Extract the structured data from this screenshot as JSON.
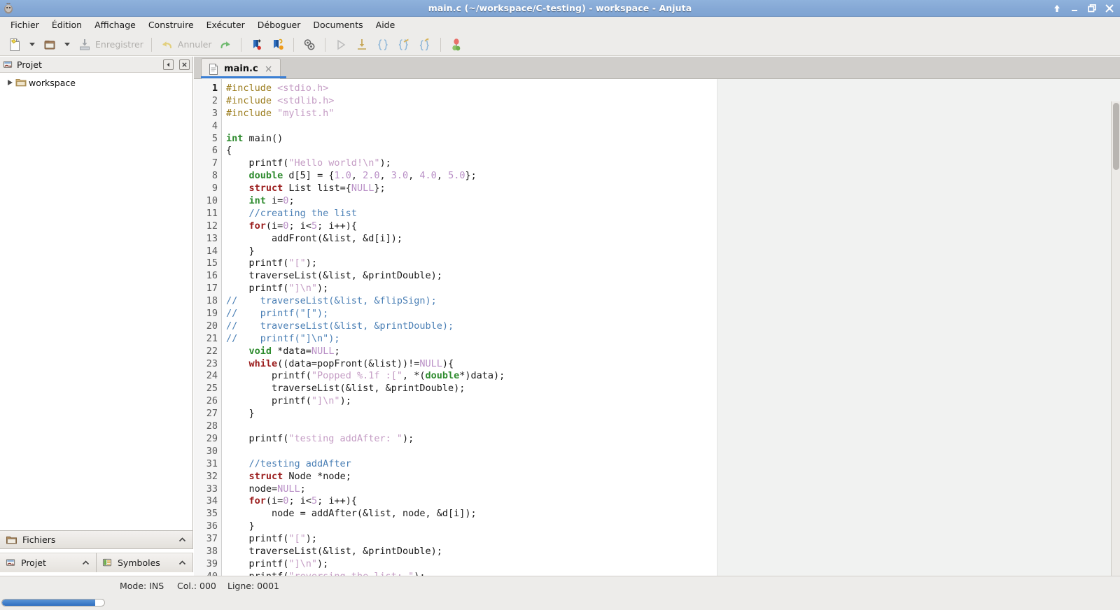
{
  "window": {
    "title": "main.c (~/workspace/C-testing) - workspace - Anjuta",
    "app_icon": "anjuta-icon",
    "controls": [
      {
        "name": "shade-button",
        "glyph": "↑"
      },
      {
        "name": "minimize-button",
        "glyph": "–"
      },
      {
        "name": "maximize-button",
        "glyph": "❐"
      },
      {
        "name": "close-button",
        "glyph": "✕"
      }
    ]
  },
  "menubar": {
    "items": [
      {
        "label": "Fichier"
      },
      {
        "label": "Édition"
      },
      {
        "label": "Affichage"
      },
      {
        "label": "Construire"
      },
      {
        "label": "Exécuter"
      },
      {
        "label": "Déboguer"
      },
      {
        "label": "Documents"
      },
      {
        "label": "Aide"
      }
    ]
  },
  "toolbar": {
    "new_label": "",
    "open_label": "",
    "save_label": "Enregistrer",
    "undo_label": "Annuler",
    "redo_label": "",
    "items": [
      {
        "name": "new-file-button",
        "icon": "new-document-icon",
        "enabled": true
      },
      {
        "name": "new-file-dropdown",
        "icon": "chevron-down-icon",
        "enabled": true
      },
      {
        "name": "open-file-button",
        "icon": "open-folder-icon",
        "enabled": true
      },
      {
        "name": "open-file-dropdown",
        "icon": "chevron-down-icon",
        "enabled": true
      },
      {
        "name": "save-button",
        "icon": "save-icon",
        "enabled": false
      },
      {
        "name": "undo-button",
        "icon": "undo-arrow-icon",
        "enabled": false
      },
      {
        "name": "redo-button",
        "icon": "redo-arrow-icon",
        "enabled": true
      },
      {
        "name": "bookmark-add-button",
        "icon": "bookmark-add-icon",
        "enabled": true
      },
      {
        "name": "bookmark-find-button",
        "icon": "bookmark-find-icon",
        "enabled": true
      },
      {
        "name": "build-button",
        "icon": "gears-icon",
        "enabled": true
      },
      {
        "name": "run-button",
        "icon": "play-triangle-icon",
        "enabled": false
      },
      {
        "name": "step-into-button",
        "icon": "step-into-icon",
        "enabled": false
      },
      {
        "name": "step-braces-button",
        "icon": "step-over-braces-icon",
        "enabled": false
      },
      {
        "name": "step-out-button",
        "icon": "step-out-icon",
        "enabled": false
      },
      {
        "name": "step-next-button",
        "icon": "step-next-icon",
        "enabled": false
      },
      {
        "name": "stop-debug-button",
        "icon": "balloon-stop-icon",
        "enabled": true
      }
    ]
  },
  "left_panel": {
    "header": {
      "icon": "project-icon",
      "title": "Projet",
      "collapse_button": "collapse-panel-icon",
      "close_button": "close-panel-icon"
    },
    "tree": [
      {
        "icon": "folder-icon",
        "label": "workspace",
        "expanded": false
      }
    ],
    "files_expander": {
      "icon": "folder-icon",
      "label": "Fichiers",
      "chevron": "chevron-up-icon"
    },
    "tabs": [
      {
        "name": "sidebar-tab-projet",
        "icon": "project-icon",
        "label": "Projet",
        "chevron": "chevron-up-icon",
        "active": true
      },
      {
        "name": "sidebar-tab-symboles",
        "icon": "symbols-icon",
        "label": "Symboles",
        "chevron": "chevron-up-icon",
        "active": false
      }
    ]
  },
  "editor": {
    "tabs": [
      {
        "name": "editor-tab-main-c",
        "icon": "file-icon",
        "label": "main.c",
        "close": "×",
        "active": true
      }
    ],
    "current_line": 1,
    "first_line": 1,
    "last_visible_line": 40,
    "code": [
      [
        [
          "pp",
          "#include "
        ],
        [
          "st",
          "<stdio.h>"
        ]
      ],
      [
        [
          "pp",
          "#include "
        ],
        [
          "st",
          "<stdlib.h>"
        ]
      ],
      [
        [
          "pp",
          "#include "
        ],
        [
          "st",
          "\"mylist.h\""
        ]
      ],
      [
        [
          "pl",
          ""
        ]
      ],
      [
        [
          "kg",
          "int"
        ],
        [
          "pl",
          " main()"
        ]
      ],
      [
        [
          "pl",
          "{"
        ]
      ],
      [
        [
          "pl",
          "    printf("
        ],
        [
          "st",
          "\"Hello world!\\n\""
        ],
        [
          "pl",
          ");"
        ]
      ],
      [
        [
          "pl",
          "    "
        ],
        [
          "kg",
          "double"
        ],
        [
          "pl",
          " d[5] = {"
        ],
        [
          "nm",
          "1.0"
        ],
        [
          "pl",
          ", "
        ],
        [
          "nm",
          "2.0"
        ],
        [
          "pl",
          ", "
        ],
        [
          "nm",
          "3.0"
        ],
        [
          "pl",
          ", "
        ],
        [
          "nm",
          "4.0"
        ],
        [
          "pl",
          ", "
        ],
        [
          "nm",
          "5.0"
        ],
        [
          "pl",
          "};"
        ]
      ],
      [
        [
          "pl",
          "    "
        ],
        [
          "k",
          "struct"
        ],
        [
          "pl",
          " List list={"
        ],
        [
          "nm",
          "NULL"
        ],
        [
          "pl",
          "};"
        ]
      ],
      [
        [
          "pl",
          "    "
        ],
        [
          "kg",
          "int"
        ],
        [
          "pl",
          " i="
        ],
        [
          "nm",
          "0"
        ],
        [
          "pl",
          ";"
        ]
      ],
      [
        [
          "pl",
          "    "
        ],
        [
          "cm",
          "//creating the list"
        ]
      ],
      [
        [
          "pl",
          "    "
        ],
        [
          "k",
          "for"
        ],
        [
          "pl",
          "(i="
        ],
        [
          "nm",
          "0"
        ],
        [
          "pl",
          "; i<"
        ],
        [
          "nm",
          "5"
        ],
        [
          "pl",
          "; i++){"
        ]
      ],
      [
        [
          "pl",
          "        addFront(&list, &d[i]);"
        ]
      ],
      [
        [
          "pl",
          "    }"
        ]
      ],
      [
        [
          "pl",
          "    printf("
        ],
        [
          "st",
          "\"[\""
        ],
        [
          "pl",
          ");"
        ]
      ],
      [
        [
          "pl",
          "    traverseList(&list, &printDouble);"
        ]
      ],
      [
        [
          "pl",
          "    printf("
        ],
        [
          "st",
          "\"]\\n\""
        ],
        [
          "pl",
          ");"
        ]
      ],
      [
        [
          "cm",
          "//    traverseList(&list, &flipSign);"
        ]
      ],
      [
        [
          "cm",
          "//    printf(\"[\");"
        ]
      ],
      [
        [
          "cm",
          "//    traverseList(&list, &printDouble);"
        ]
      ],
      [
        [
          "cm",
          "//    printf(\"]\\n\");"
        ]
      ],
      [
        [
          "pl",
          "    "
        ],
        [
          "kg",
          "void"
        ],
        [
          "pl",
          " *data="
        ],
        [
          "nm",
          "NULL"
        ],
        [
          "pl",
          ";"
        ]
      ],
      [
        [
          "pl",
          "    "
        ],
        [
          "k",
          "while"
        ],
        [
          "pl",
          "((data=popFront(&list))!="
        ],
        [
          "nm",
          "NULL"
        ],
        [
          "pl",
          "){"
        ]
      ],
      [
        [
          "pl",
          "        printf("
        ],
        [
          "st",
          "\"Popped %.1f :[\""
        ],
        [
          "pl",
          ", *("
        ],
        [
          "kg",
          "double"
        ],
        [
          "pl",
          "*)data);"
        ]
      ],
      [
        [
          "pl",
          "        traverseList(&list, &printDouble);"
        ]
      ],
      [
        [
          "pl",
          "        printf("
        ],
        [
          "st",
          "\"]\\n\""
        ],
        [
          "pl",
          ");"
        ]
      ],
      [
        [
          "pl",
          "    }"
        ]
      ],
      [
        [
          "pl",
          ""
        ]
      ],
      [
        [
          "pl",
          "    printf("
        ],
        [
          "st",
          "\"testing addAfter: \""
        ],
        [
          "pl",
          ");"
        ]
      ],
      [
        [
          "pl",
          ""
        ]
      ],
      [
        [
          "pl",
          "    "
        ],
        [
          "cm",
          "//testing addAfter"
        ]
      ],
      [
        [
          "pl",
          "    "
        ],
        [
          "k",
          "struct"
        ],
        [
          "pl",
          " Node *node;"
        ]
      ],
      [
        [
          "pl",
          "    node="
        ],
        [
          "nm",
          "NULL"
        ],
        [
          "pl",
          ";"
        ]
      ],
      [
        [
          "pl",
          "    "
        ],
        [
          "k",
          "for"
        ],
        [
          "pl",
          "(i="
        ],
        [
          "nm",
          "0"
        ],
        [
          "pl",
          "; i<"
        ],
        [
          "nm",
          "5"
        ],
        [
          "pl",
          "; i++){"
        ]
      ],
      [
        [
          "pl",
          "        node = addAfter(&list, node, &d[i]);"
        ]
      ],
      [
        [
          "pl",
          "    }"
        ]
      ],
      [
        [
          "pl",
          "    printf("
        ],
        [
          "st",
          "\"[\""
        ],
        [
          "pl",
          ");"
        ]
      ],
      [
        [
          "pl",
          "    traverseList(&list, &printDouble);"
        ]
      ],
      [
        [
          "pl",
          "    printf("
        ],
        [
          "st",
          "\"]\\n\""
        ],
        [
          "pl",
          ");"
        ]
      ],
      [
        [
          "pl",
          "    printf("
        ],
        [
          "st",
          "\"reversing the list: \""
        ],
        [
          "pl",
          ");"
        ]
      ]
    ]
  },
  "statusbar": {
    "mode": "Mode: INS",
    "column": "Col.: 000",
    "line": "Ligne: 0001"
  },
  "progress": {
    "percent": 91
  },
  "colors": {
    "titlebar": "#86a9d6",
    "chrome": "#edecea",
    "accent": "#3b7fd4",
    "keyword": "#9a1b1b",
    "type_keyword": "#2e8b2e",
    "preprocessor": "#9a7b1b",
    "string": "#c49cc4",
    "comment": "#4a7fb5",
    "number": "#b98fc6"
  }
}
